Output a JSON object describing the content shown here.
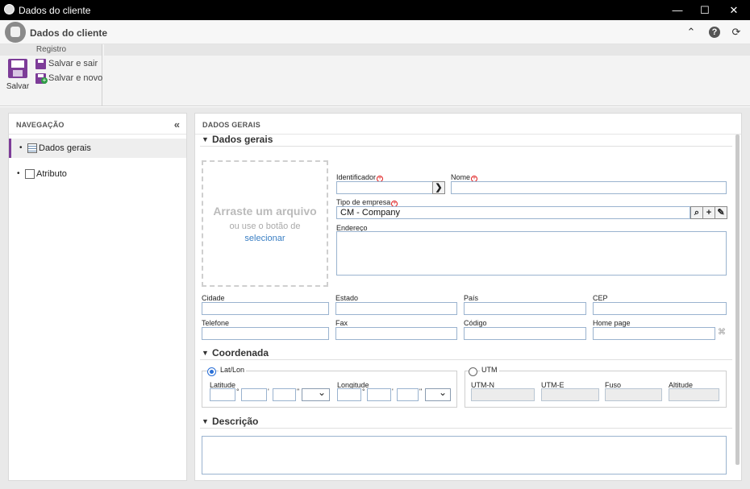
{
  "window": {
    "title": "Dados do cliente",
    "minimize": "—",
    "maximize": "☐",
    "close": "✕"
  },
  "header": {
    "title": "Dados do cliente",
    "collapse_icon": "⌃",
    "help_icon": "?",
    "refresh_icon": "⟳"
  },
  "ribbon": {
    "group_label": "Registro",
    "save_label": "Salvar",
    "save_exit_label": "Salvar e sair",
    "save_new_label": "Salvar e novo"
  },
  "navigation": {
    "header": "NAVEGAÇÃO",
    "collapse_icon": "«",
    "items": [
      {
        "label": "Dados gerais",
        "active": true
      },
      {
        "label": "Atributo",
        "active": false
      }
    ]
  },
  "main": {
    "header": "DADOS GERAIS",
    "sections": {
      "general": "Dados gerais",
      "coordinates": "Coordenada",
      "description": "Descrição"
    },
    "dropzone": {
      "title": "Arraste um arquivo",
      "subtitle": "ou use o botão de",
      "link": "selecionar"
    },
    "fields": {
      "identificador": {
        "label": "Identificador",
        "value": ""
      },
      "nome": {
        "label": "Nome",
        "value": ""
      },
      "tipo_empresa": {
        "label": "Tipo de empresa",
        "value": "CM - Company"
      },
      "endereco": {
        "label": "Endereço",
        "value": ""
      },
      "cidade": {
        "label": "Cidade",
        "value": ""
      },
      "estado": {
        "label": "Estado",
        "value": ""
      },
      "pais": {
        "label": "País",
        "value": ""
      },
      "cep": {
        "label": "CEP",
        "value": ""
      },
      "telefone": {
        "label": "Telefone",
        "value": ""
      },
      "fax": {
        "label": "Fax",
        "value": ""
      },
      "codigo": {
        "label": "Código",
        "value": ""
      },
      "homepage": {
        "label": "Home page",
        "value": ""
      }
    },
    "coordinates": {
      "latlon_label": "Lat/Lon",
      "latlon_selected": true,
      "latitude_label": "Latitude",
      "longitude_label": "Longitude",
      "degree_symbol": "°",
      "minute_symbol": "'",
      "second_symbol": "\"",
      "utm_label": "UTM",
      "utm_selected": false,
      "utm_n_label": "UTM-N",
      "utm_e_label": "UTM-E",
      "fuso_label": "Fuso",
      "altitude_label": "Altitude"
    },
    "buttons": {
      "go_icon": "❯",
      "search_icon": "⌕",
      "add_icon": "+",
      "clear_icon": "✎",
      "binoculars_icon": "⌘"
    }
  },
  "colors": {
    "accent": "#7d3c98",
    "link": "#3a7fc4",
    "required": "#e02020",
    "field_border": "#9ab3cf"
  }
}
